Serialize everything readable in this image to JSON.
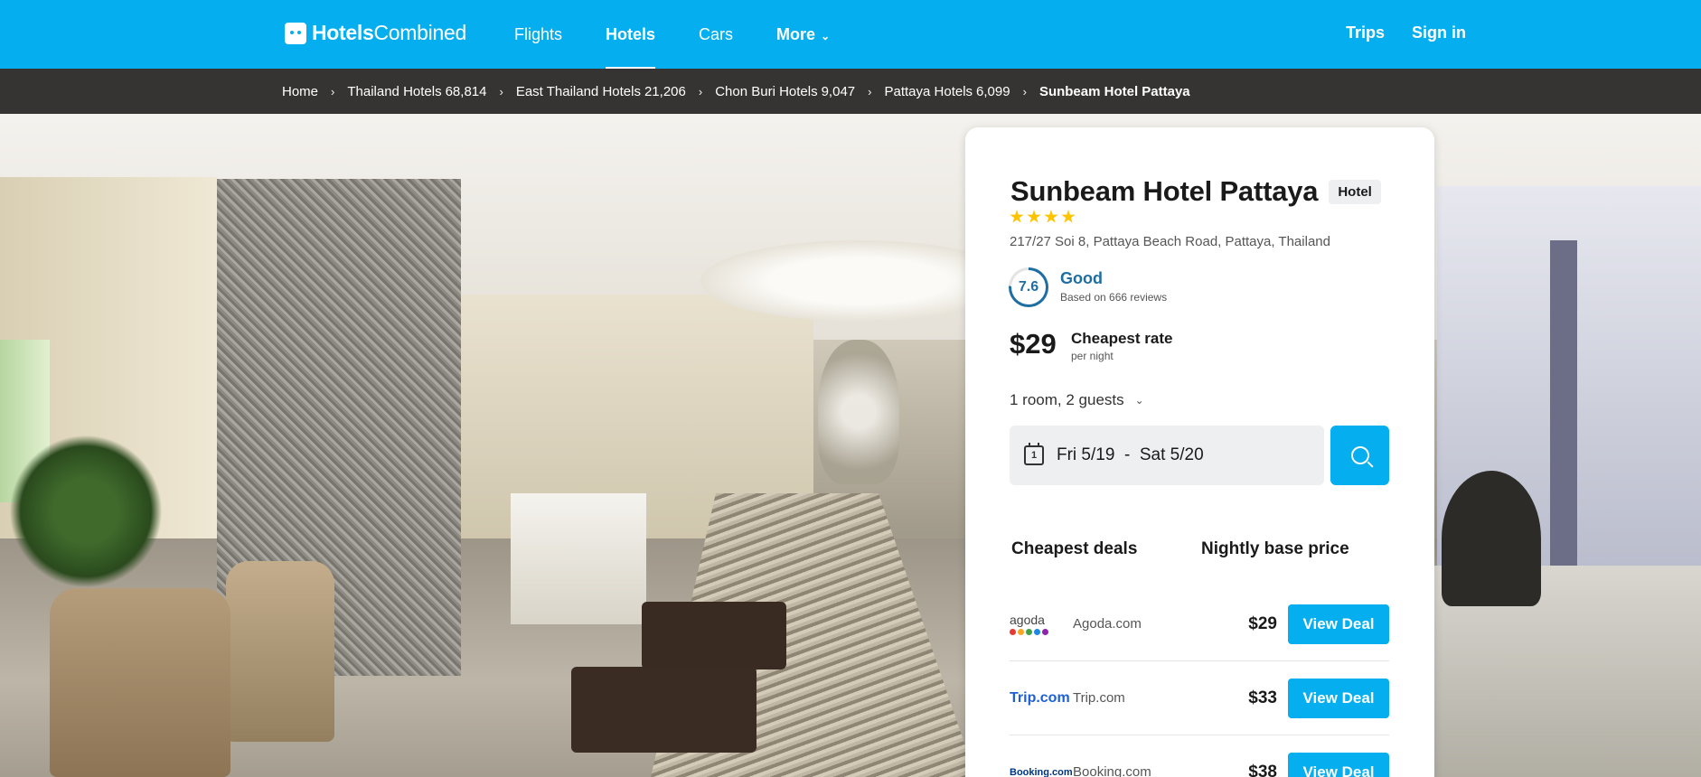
{
  "header": {
    "logo": {
      "bold": "Hotels",
      "light": "Combined"
    },
    "nav": [
      {
        "label": "Flights"
      },
      {
        "label": "Hotels"
      },
      {
        "label": "Cars"
      },
      {
        "label": "More"
      }
    ],
    "trips_label": "Trips",
    "signin_label": "Sign in"
  },
  "breadcrumb": [
    {
      "label": "Home",
      "count": ""
    },
    {
      "label": "Thailand Hotels",
      "count": "68,814"
    },
    {
      "label": "East Thailand Hotels",
      "count": "21,206"
    },
    {
      "label": "Chon Buri Hotels",
      "count": "9,047"
    },
    {
      "label": "Pattaya Hotels",
      "count": "6,099"
    },
    {
      "label": "Sunbeam Hotel Pattaya",
      "count": ""
    }
  ],
  "hotel": {
    "name": "Sunbeam Hotel Pattaya",
    "type_badge": "Hotel",
    "stars": 4,
    "address": "217/27 Soi 8, Pattaya Beach Road, Pattaya, Thailand",
    "rating": {
      "score": "7.6",
      "label": "Good",
      "reviews": "Based on 666 reviews"
    },
    "price": {
      "amount": "$29",
      "label": "Cheapest rate",
      "sub": "per night"
    },
    "guests": "1 room, 2 guests",
    "dates": {
      "checkin": "Fri 5/19",
      "separator": "-",
      "checkout": "Sat 5/20",
      "calendar_digit": "1"
    }
  },
  "deals": {
    "header_left": "Cheapest deals",
    "header_right": "Nightly base price",
    "rows": [
      {
        "logo_text": "agoda",
        "provider": "Agoda.com",
        "price": "$29",
        "button": "View Deal",
        "logo_icon": "agoda-logo"
      },
      {
        "logo_text": "Trip.com",
        "provider": "Trip.com",
        "price": "$33",
        "button": "View Deal",
        "logo_icon": "trip-logo"
      },
      {
        "logo_text": "Booking.com",
        "provider": "Booking.com",
        "price": "$38",
        "button": "View Deal",
        "logo_icon": "booking-logo"
      }
    ]
  },
  "colors": {
    "brand": "#05aeef",
    "rating": "#1f6ea3",
    "star": "#ffc400",
    "agoda_dots": [
      "#e53935",
      "#f9a825",
      "#43a047",
      "#1e88e5",
      "#8e24aa"
    ]
  },
  "icons": {
    "search": "search-icon",
    "calendar": "calendar-icon",
    "chevron": "chevron-down-icon",
    "breadcrumb_sep": "chevron-right-icon"
  }
}
